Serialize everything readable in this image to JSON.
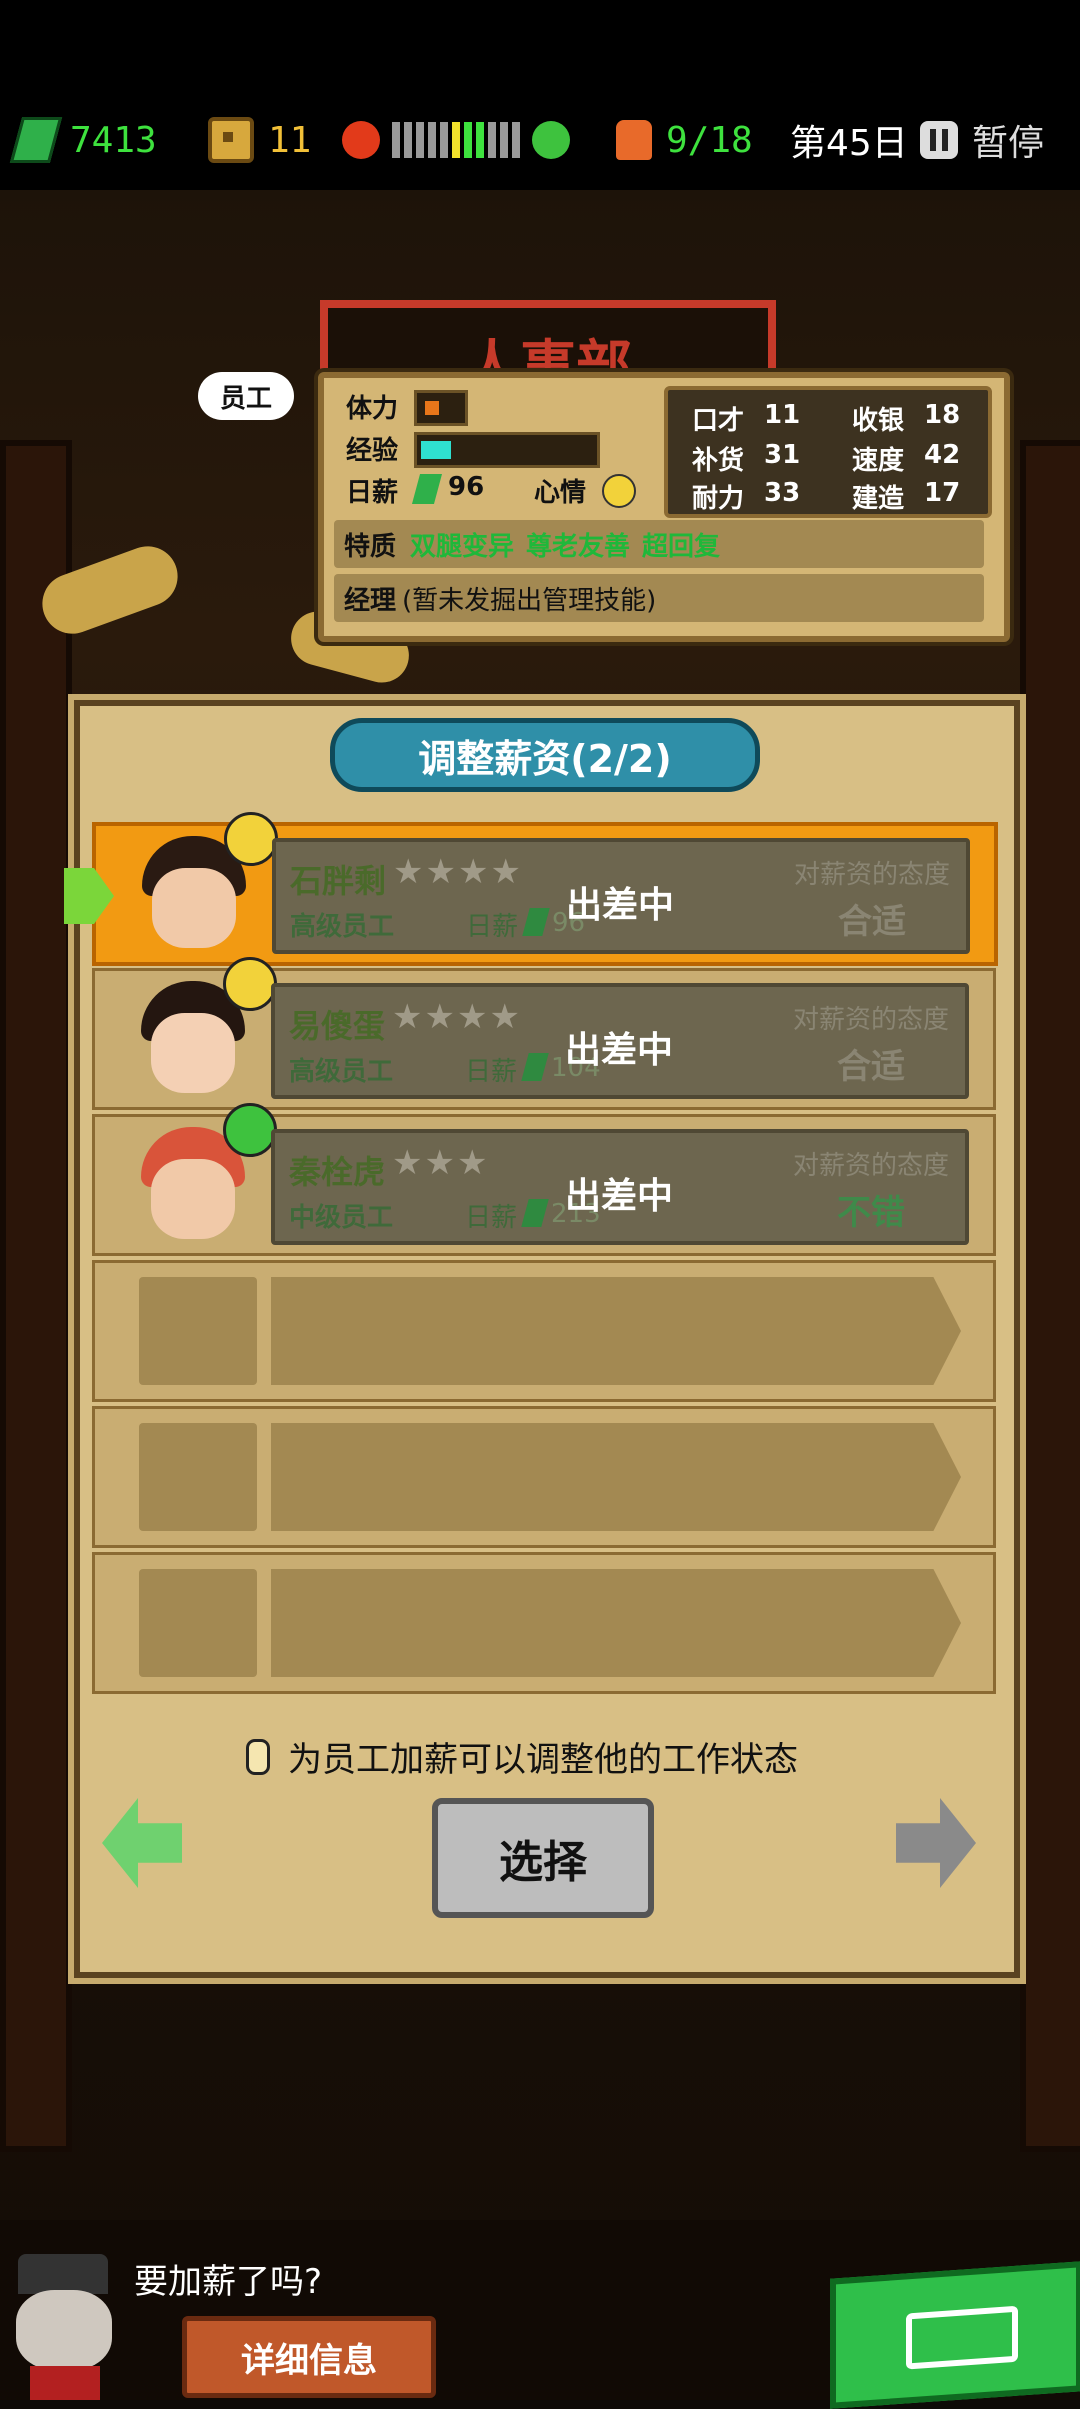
{
  "top_bar": {
    "money": "7413",
    "coins": "11",
    "mood_segments": 11,
    "mood_green_index": [
      6,
      7
    ],
    "mood_yellow_index": [
      5
    ],
    "staff_count": "9/18",
    "day": "第45日",
    "pause_label": "暂停",
    "colors": {
      "money": "#2fb04a",
      "text": "#3ee23e"
    }
  },
  "background": {
    "sign_text": "人事部"
  },
  "employee_info": {
    "tag": "员工",
    "stamina_label": "体力",
    "exp_label": "经验",
    "exp_fill": 0.18,
    "daily_pay_label": "日薪",
    "daily_pay_value": "96",
    "mood_label": "心情",
    "stats": [
      {
        "label": "口才",
        "value": "11"
      },
      {
        "label": "收银",
        "value": "18"
      },
      {
        "label": "补货",
        "value": "31"
      },
      {
        "label": "速度",
        "value": "42"
      },
      {
        "label": "耐力",
        "value": "33"
      },
      {
        "label": "建造",
        "value": "17"
      }
    ],
    "traits_label": "特质",
    "traits": [
      "双腿变异",
      "尊老友善",
      "超回复"
    ],
    "manager_label": "经理",
    "manager_text": "(暂未发掘出管理技能)"
  },
  "list_panel": {
    "title": "调整薪资(2/2)",
    "salary_attitude_label": "对薪资的态度",
    "daily_pay_label": "日薪",
    "rows": [
      {
        "name": "石胖剩",
        "rank": "高级员工",
        "salary": "96",
        "status": "出差中",
        "attitude": "合适",
        "stars": 4,
        "mood": "neutral",
        "selected": true
      },
      {
        "name": "易傻蛋",
        "rank": "高级员工",
        "salary": "104",
        "status": "出差中",
        "attitude": "合适",
        "stars": 4,
        "mood": "neutral",
        "selected": false
      },
      {
        "name": "秦栓虎",
        "rank": "中级员工",
        "salary": "213",
        "status": "出差中",
        "attitude": "不错",
        "stars": 3,
        "mood": "happy",
        "selected": false
      }
    ],
    "empty_slots": 3,
    "tip": "为员工加薪可以调整他的工作状态",
    "select_button": "选择"
  },
  "bottom": {
    "dialog": "要加薪了吗?",
    "detail_button": "详细信息"
  }
}
